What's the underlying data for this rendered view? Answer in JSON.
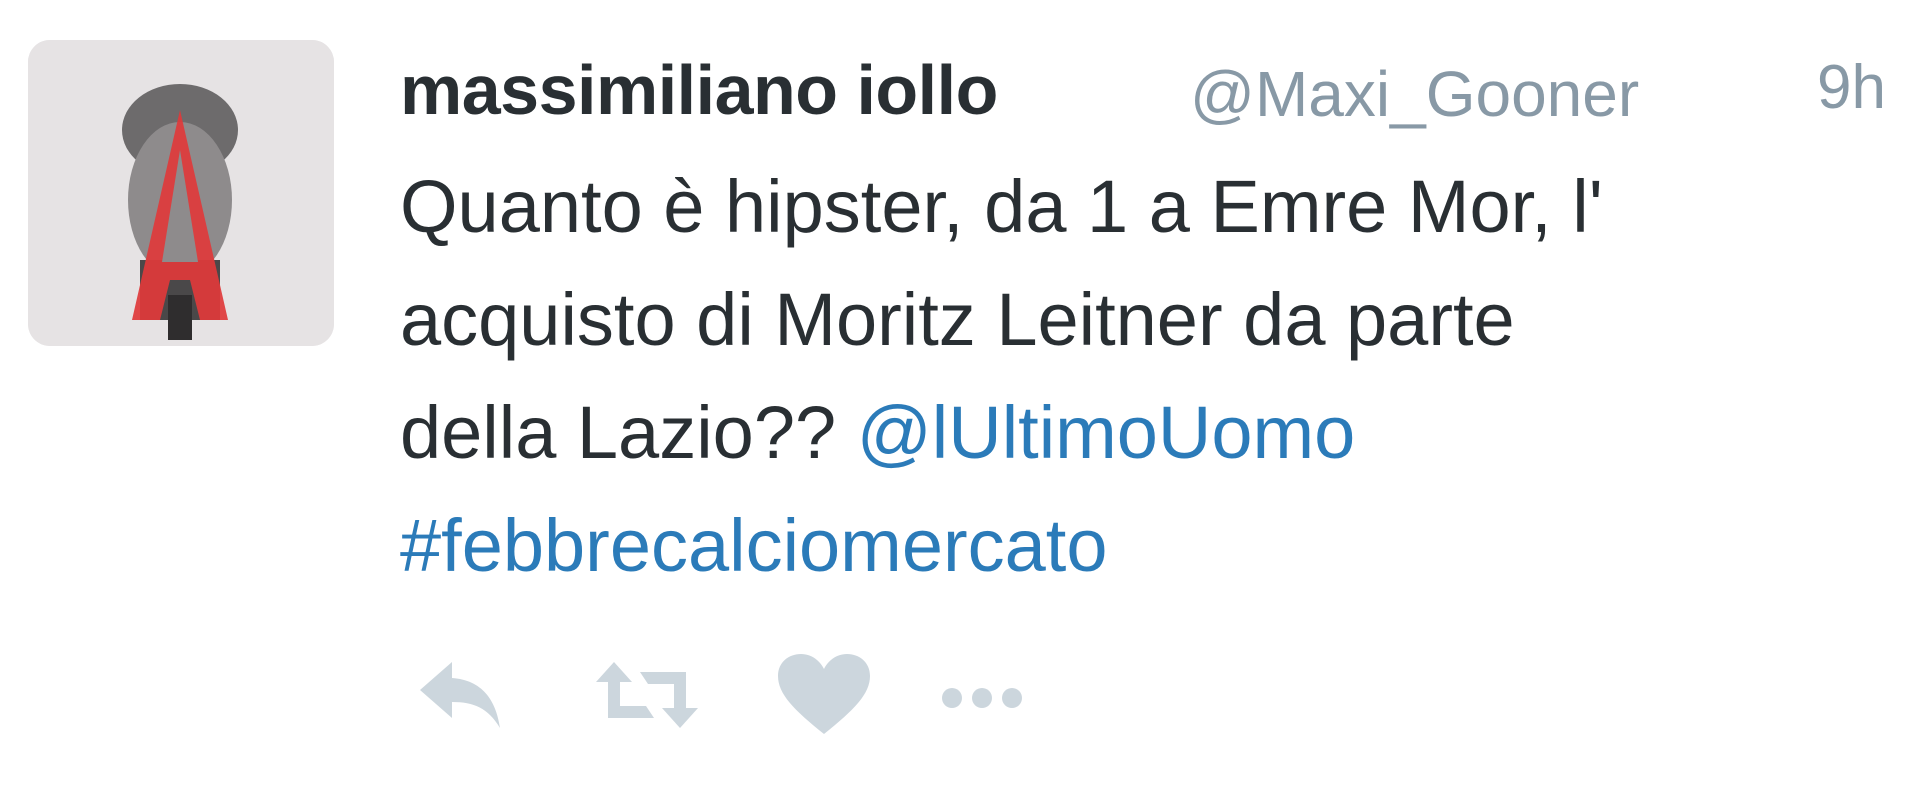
{
  "tweet": {
    "fullname": "massimiliano iollo",
    "username": "@Maxi_Gooner",
    "timestamp": "9h",
    "text_line1": "Quanto è hipster, da 1 a Emre Mor, l'",
    "text_line2": "acquisto di Moritz Leitner da parte",
    "text_line3_plain": "della Lazio?? ",
    "mention": "@lUltimoUomo",
    "hashtag": "#febbrecalciomercato"
  },
  "icons": {
    "avatar": "avatar-portrait-red-a",
    "reply": "reply-icon",
    "retweet": "retweet-icon",
    "like": "heart-icon",
    "more": "more-icon"
  },
  "colors": {
    "name": "#292f33",
    "meta": "#8899a6",
    "link": "#2b7bb9",
    "action": "#ccd6dd",
    "avatar_accent": "#e0393b"
  }
}
